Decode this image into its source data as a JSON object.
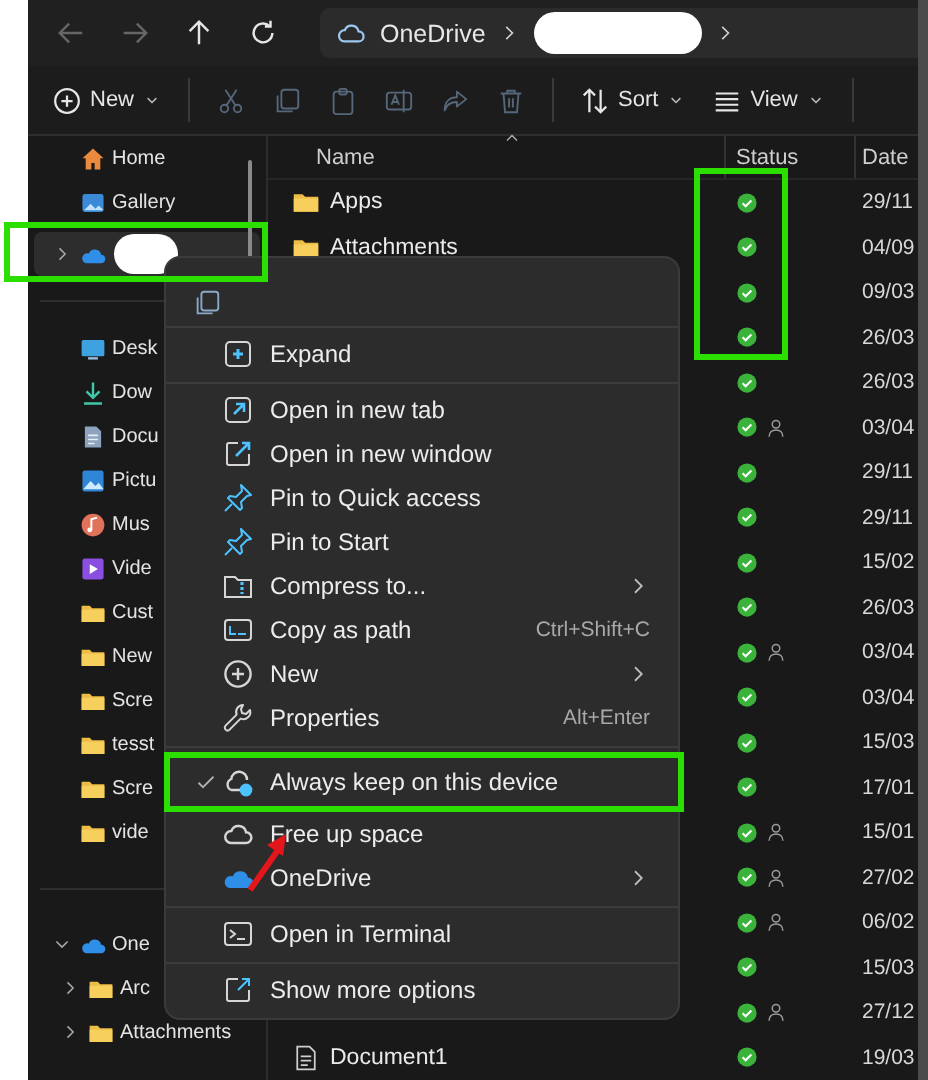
{
  "nav_buttons": [
    {
      "kind": "back",
      "disabled": true
    },
    {
      "kind": "forward",
      "disabled": true
    },
    {
      "kind": "up",
      "disabled": false
    },
    {
      "kind": "refresh",
      "disabled": false
    }
  ],
  "address": {
    "segments": [
      {
        "label": "OneDrive",
        "redacted": false
      },
      {
        "redacted": true
      }
    ]
  },
  "toolbar": {
    "items": [
      {
        "kind": "new",
        "label": "New",
        "disabled": false
      },
      {
        "kind": "separator"
      },
      {
        "kind": "cut",
        "disabled": true
      },
      {
        "kind": "copy",
        "disabled": true
      },
      {
        "kind": "paste",
        "disabled": true
      },
      {
        "kind": "rename",
        "disabled": true
      },
      {
        "kind": "share",
        "disabled": true
      },
      {
        "kind": "delete",
        "disabled": true
      },
      {
        "kind": "separator"
      },
      {
        "kind": "sort",
        "label": "Sort",
        "disabled": false
      },
      {
        "kind": "view",
        "label": "View",
        "disabled": false
      },
      {
        "kind": "separator"
      }
    ]
  },
  "sidebar": {
    "sections": [
      {
        "items": [
          {
            "label": "Home",
            "selected": false
          },
          {
            "label": "Gallery",
            "selected": false
          },
          {
            "redacted": true,
            "selected": true,
            "expanded": false
          }
        ]
      },
      {
        "items": [
          {
            "label": "Desk",
            "selected": false
          },
          {
            "label": "Dow",
            "selected": false
          },
          {
            "label": "Docu",
            "selected": false
          },
          {
            "label": "Pictu",
            "selected": false
          },
          {
            "label": "Mus",
            "selected": false
          },
          {
            "label": "Vide",
            "selected": false
          },
          {
            "label": "Cust",
            "selected": false
          },
          {
            "label": "New",
            "selected": false
          },
          {
            "label": "Scre",
            "selected": false
          },
          {
            "label": "tesst",
            "selected": false
          },
          {
            "label": "Scre",
            "selected": false
          },
          {
            "label": "vide",
            "selected": false
          }
        ]
      },
      {
        "items": [
          {
            "label": "One",
            "selected": false,
            "expanded": true,
            "children": [
              {
                "label": "Arc",
                "selected": false,
                "expanded": false
              },
              {
                "label": "Attachments",
                "selected": false,
                "expanded": false
              }
            ]
          }
        ]
      }
    ]
  },
  "columns": [
    {
      "label": "Name"
    },
    {
      "label": "Status"
    },
    {
      "label": "Date"
    }
  ],
  "rows": [
    {
      "kind": "folder",
      "name": "Apps",
      "shared": false,
      "date": "29/11"
    },
    {
      "kind": "folder",
      "name": "Attachments",
      "shared": false,
      "date": "04/09"
    },
    {
      "shared": false,
      "date": "09/03"
    },
    {
      "shared": false,
      "date": "26/03"
    },
    {
      "shared": false,
      "date": "26/03"
    },
    {
      "shared": true,
      "date": "03/04"
    },
    {
      "shared": false,
      "date": "29/11"
    },
    {
      "shared": false,
      "date": "29/11"
    },
    {
      "shared": false,
      "date": "15/02"
    },
    {
      "shared": false,
      "date": "26/03"
    },
    {
      "shared": true,
      "date": "03/04"
    },
    {
      "shared": false,
      "date": "03/04"
    },
    {
      "shared": false,
      "date": "15/03"
    },
    {
      "shared": false,
      "date": "17/01"
    },
    {
      "shared": true,
      "date": "15/01"
    },
    {
      "shared": true,
      "date": "27/02"
    },
    {
      "shared": true,
      "date": "06/02"
    },
    {
      "shared": false,
      "date": "15/03"
    },
    {
      "shared": true,
      "date": "27/12"
    },
    {
      "kind": "file",
      "name": "Document1",
      "shared": false,
      "date": "19/03"
    }
  ],
  "context_menu": {
    "items": [
      {
        "kind": "icon_row"
      },
      {
        "kind": "separator"
      },
      {
        "kind": "item",
        "label": "Expand",
        "checked": false,
        "submenu": false
      },
      {
        "kind": "separator"
      },
      {
        "kind": "item",
        "label": "Open in new tab",
        "checked": false,
        "submenu": false
      },
      {
        "kind": "item",
        "label": "Open in new window",
        "checked": false,
        "submenu": false
      },
      {
        "kind": "item",
        "label": "Pin to Quick access",
        "checked": false,
        "submenu": false
      },
      {
        "kind": "item",
        "label": "Pin to Start",
        "checked": false,
        "submenu": false
      },
      {
        "kind": "item",
        "label": "Compress to...",
        "checked": false,
        "submenu": true
      },
      {
        "kind": "item",
        "label": "Copy as path",
        "shortcut": "Ctrl+Shift+C",
        "checked": false,
        "submenu": false
      },
      {
        "kind": "item",
        "label": "New",
        "checked": false,
        "submenu": true
      },
      {
        "kind": "item",
        "label": "Properties",
        "shortcut": "Alt+Enter",
        "checked": false,
        "submenu": false
      },
      {
        "kind": "separator"
      },
      {
        "kind": "item",
        "label": "Always keep on this device",
        "checked": true,
        "submenu": false
      },
      {
        "kind": "item",
        "label": "Free up space",
        "checked": false,
        "submenu": false
      },
      {
        "kind": "item",
        "label": "OneDrive",
        "checked": false,
        "submenu": true
      },
      {
        "kind": "separator"
      },
      {
        "kind": "item",
        "label": "Open in Terminal",
        "checked": false,
        "submenu": false
      },
      {
        "kind": "separator"
      },
      {
        "kind": "item",
        "label": "Show more options",
        "checked": false,
        "submenu": false
      }
    ]
  }
}
